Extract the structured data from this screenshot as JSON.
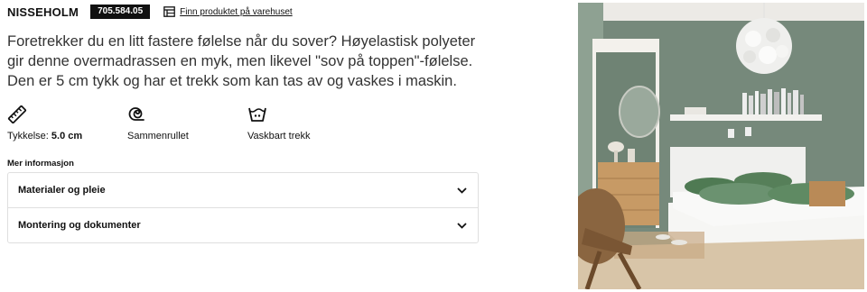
{
  "product": {
    "name": "NISSEHOLM",
    "article_number": "705.584.05",
    "store_link_label": "Finn produktet på varehuset",
    "description": "Foretrekker du en litt fastere følelse når du sover? Høyelastisk polyeter gir denne overmadrassen en myk, men likevel \"sov på toppen\"-følelse. Den er 5 cm tykk og har et trekk som kan tas av og vaskes i maskin."
  },
  "features": [
    {
      "icon": "ruler-icon",
      "label": "Tykkelse:",
      "value": "5.0 cm"
    },
    {
      "icon": "rolled-icon",
      "label": "Sammenrullet",
      "value": ""
    },
    {
      "icon": "washable-icon",
      "label": "Vaskbart trekk",
      "value": ""
    }
  ],
  "more_info": {
    "heading": "Mer informasjon",
    "sections": [
      {
        "title": "Materialer og pleie"
      },
      {
        "title": "Montering og dokumenter"
      }
    ]
  },
  "image": {
    "alt": "Soverom med seng og overmadrass"
  }
}
